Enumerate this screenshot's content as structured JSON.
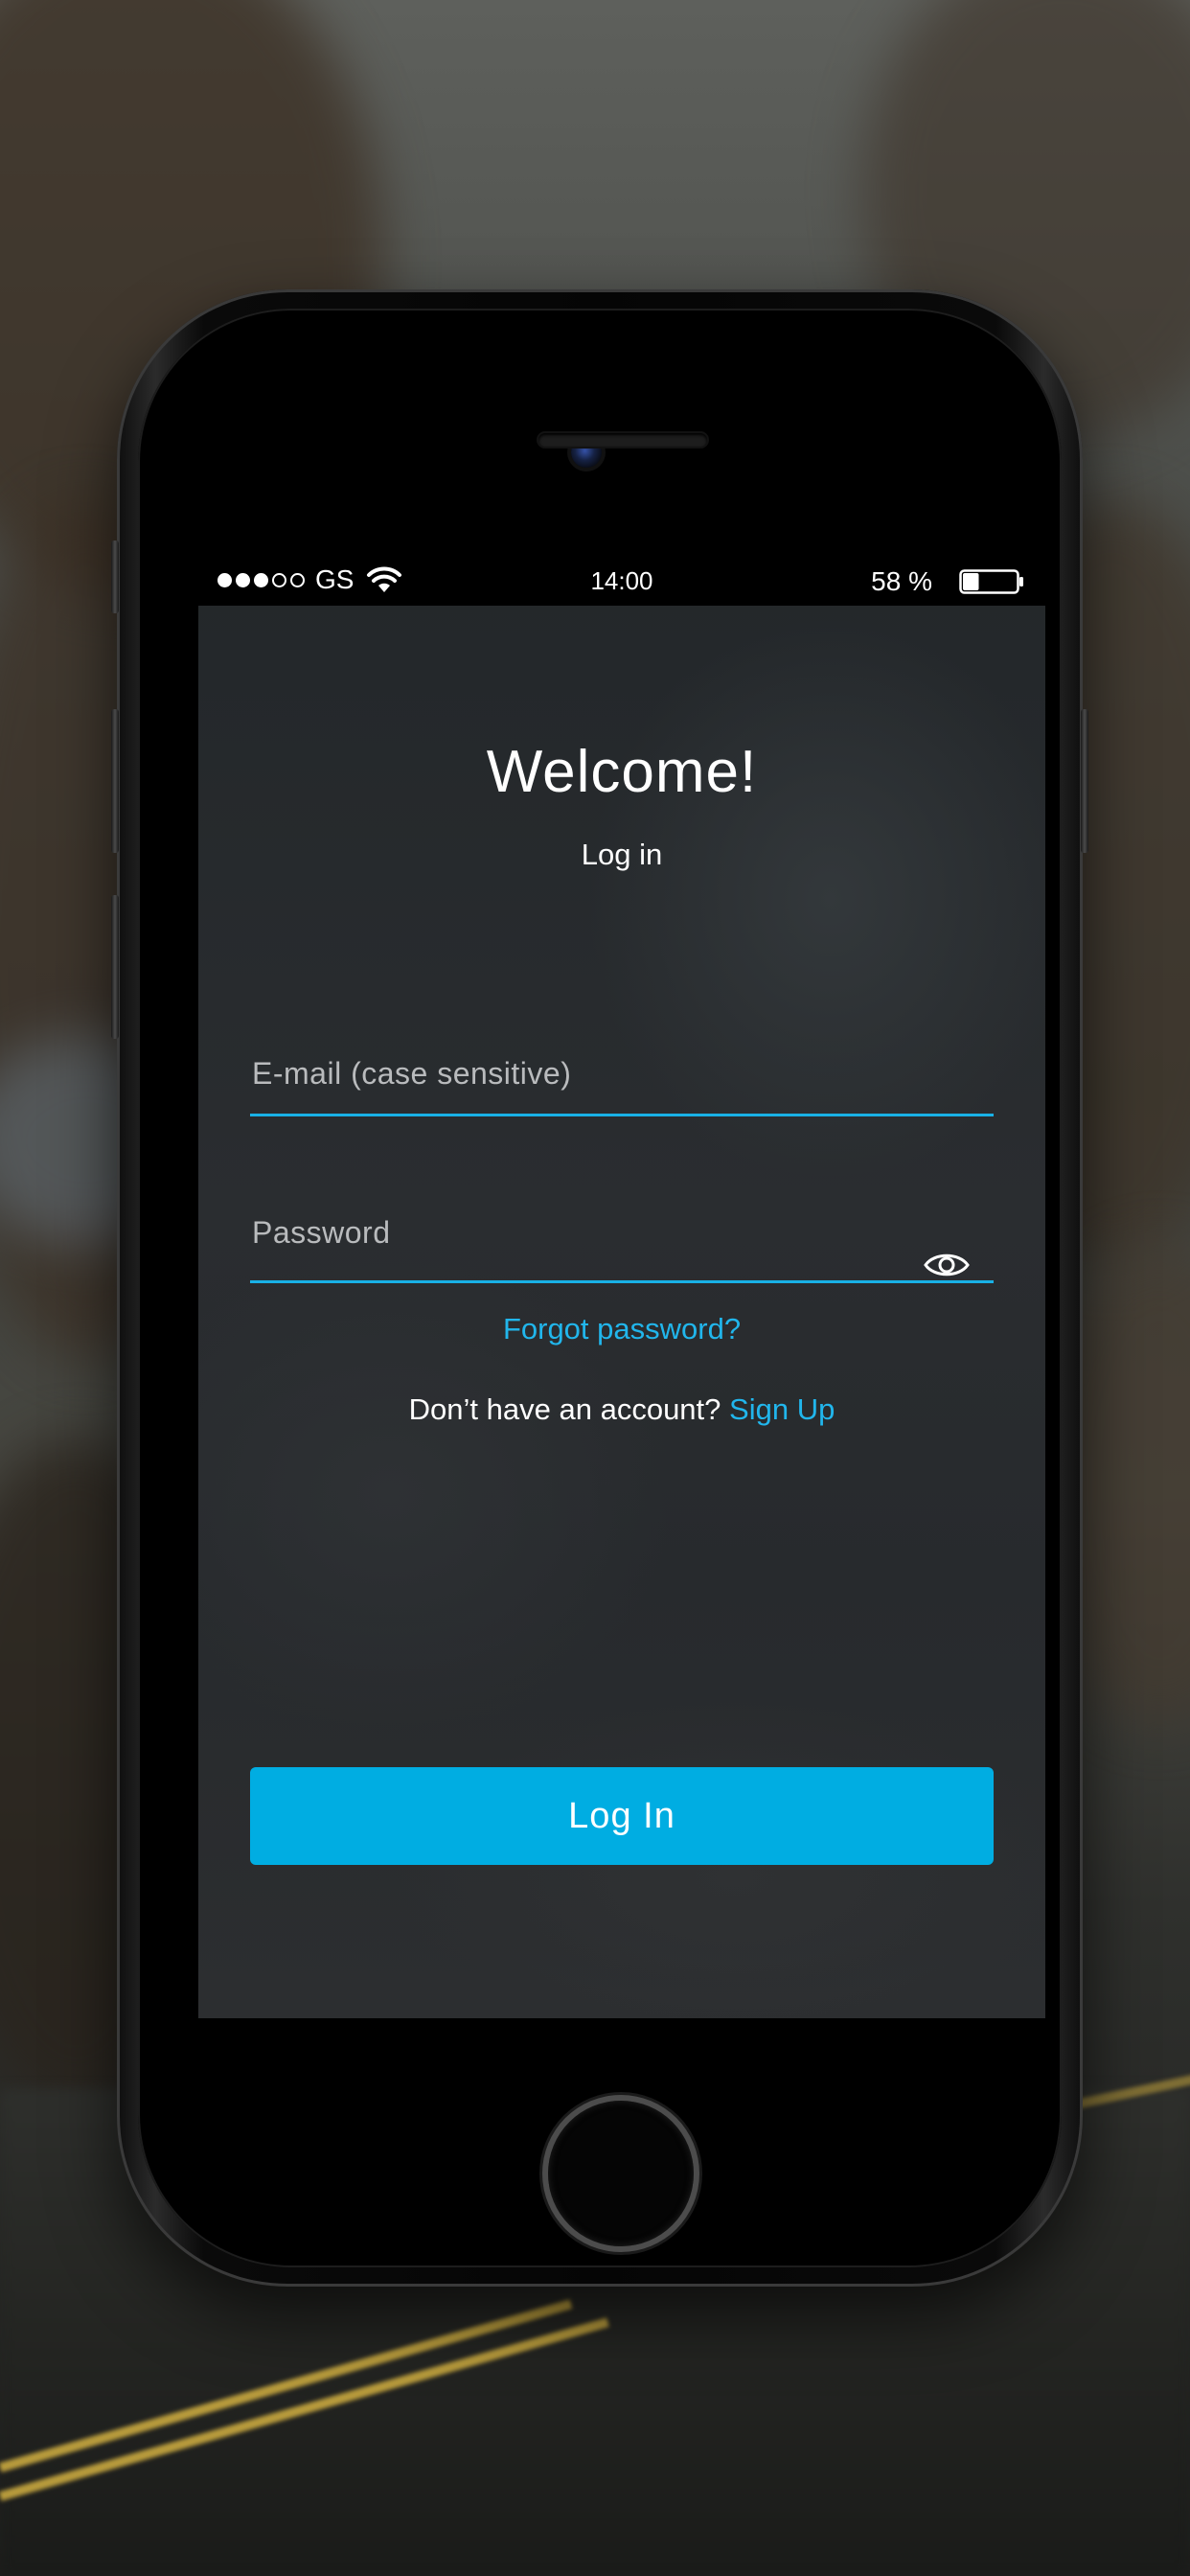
{
  "status_bar": {
    "signal_total": 5,
    "signal_filled": 3,
    "carrier": "GS",
    "wifi_icon": "wifi-icon",
    "time": "14:00",
    "battery_percent": "58 %",
    "battery_level": 0.3,
    "battery_icon": "battery-icon"
  },
  "header": {
    "title": "Welcome!",
    "subtitle": "Log in"
  },
  "form": {
    "email": {
      "placeholder": "E-mail (case sensitive)",
      "value": ""
    },
    "password": {
      "placeholder": "Password",
      "value": "",
      "toggle_icon": "eye-icon"
    },
    "forgot_password": "Forgot password?",
    "signup_prompt": "Don’t have an account?",
    "signup_link": "Sign Up",
    "submit_label": "Log In"
  },
  "colors": {
    "accent": "#00ade2",
    "link": "#21b6ec",
    "underline": "#19b1e6",
    "screen_bg": "#25282b"
  }
}
